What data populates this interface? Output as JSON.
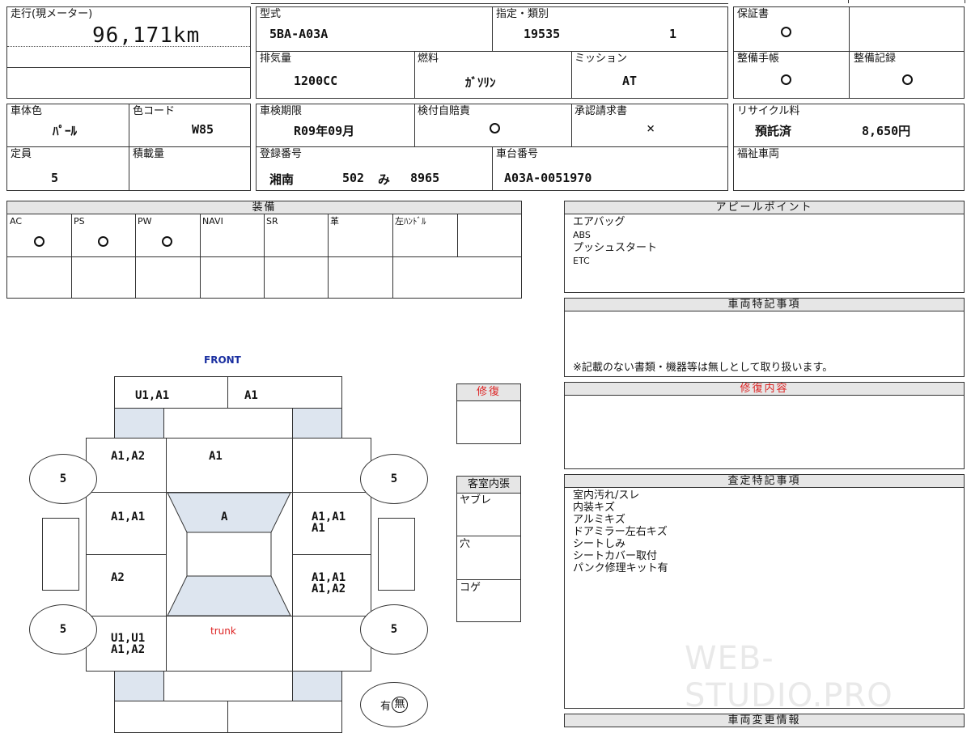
{
  "top": {
    "mileage_label": "走行(現メーター)",
    "mileage_value": "96,171km",
    "model_label": "型式",
    "model_value": "5BA-A03A",
    "designation_label": "指定・類別",
    "designation_value": "19535",
    "class_value": "1",
    "warranty_label": "保証書",
    "displacement_label": "排気量",
    "displacement_value": "1200CC",
    "fuel_label": "燃料",
    "fuel_value": "ｶﾞｿﾘﾝ",
    "transmission_label": "ミッション",
    "transmission_value": "AT",
    "maintenance_book_label": "整備手帳",
    "maintenance_record_label": "整備記録",
    "color_label": "車体色",
    "color_value": "ﾊﾟｰﾙ",
    "color_code_label": "色コード",
    "color_code_value": "W85",
    "inspection_label": "車検期限",
    "inspection_value": "R09年09月",
    "insurance_label": "検付自賠責",
    "approval_label": "承認請求書",
    "approval_value": "×",
    "recycle_label": "リサイクル料",
    "recycle_status": "預託済",
    "recycle_amount": "8,650円",
    "capacity_label": "定員",
    "capacity_value": "5",
    "load_label": "積載量",
    "reg_label": "登録番号",
    "reg_area": "湘南",
    "reg_class": "502",
    "reg_kana": "み",
    "reg_number": "8965",
    "chassis_label": "車台番号",
    "chassis_value": "A03A-0051970",
    "welfare_label": "福祉車両"
  },
  "equipment": {
    "title": "装備",
    "items": [
      "AC",
      "PS",
      "PW",
      "NAVI",
      "SR",
      "革",
      "左ﾊﾝﾄﾞﾙ"
    ]
  },
  "appeal": {
    "title": "アピールポイント",
    "lines": [
      "エアバッグ",
      "ABS",
      "プッシュスタート",
      "ETC"
    ]
  },
  "notes": {
    "title": "車両特記事項",
    "footer": "※記載のない書類・機器等は無しとして取り扱います。"
  },
  "repair": {
    "title": "修復内容",
    "small_title": "修復"
  },
  "interior": {
    "title": "客室内張",
    "rows": [
      "ヤブレ",
      "穴",
      "コゲ"
    ]
  },
  "assessment": {
    "title": "査定特記事項",
    "lines": [
      "室内汚れ/スレ",
      "内装キズ",
      "アルミキズ",
      "ドアミラー左右キズ",
      "シートしみ",
      "シートカバー取付",
      "パンク修理キット有"
    ]
  },
  "changes": {
    "title": "車両変更情報"
  },
  "diagram": {
    "front": "FRONT",
    "trunk": "trunk",
    "front_left": "U1,A1",
    "front_right": "A1",
    "left_fender": "A1,A2",
    "hood": "A1",
    "left_front_door": "A1,A1",
    "roof": "A",
    "right_front_door": "A1,A1\nA1",
    "left_rear_door": "A2",
    "right_rear_door": "A1,A1\nA1,A2",
    "left_quarter": "U1,U1\nA1,A2",
    "tire_fl": "5",
    "tire_fr": "5",
    "tire_rl": "5",
    "tire_rr": "5",
    "spare_yes": "有",
    "spare_no": "無"
  },
  "watermark": "WEB-STUDIO.PRO"
}
